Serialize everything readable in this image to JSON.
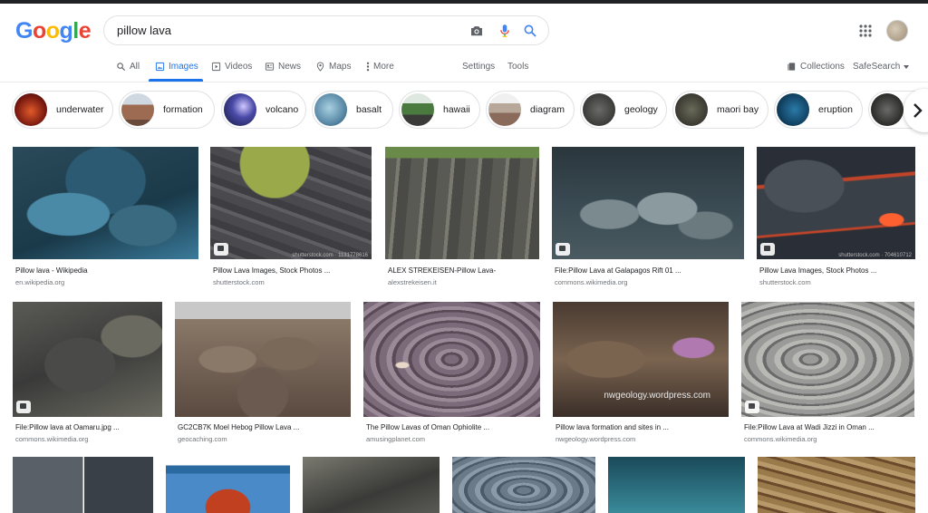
{
  "logo": {
    "letters": [
      "G",
      "o",
      "o",
      "g",
      "l",
      "e"
    ]
  },
  "search": {
    "query": "pillow lava"
  },
  "nav": {
    "tabs": [
      {
        "label": "All",
        "icon": "search-icon"
      },
      {
        "label": "Images",
        "icon": "image-icon",
        "active": true
      },
      {
        "label": "Videos",
        "icon": "play-icon"
      },
      {
        "label": "News",
        "icon": "newspaper-icon"
      },
      {
        "label": "Maps",
        "icon": "pin-icon"
      },
      {
        "label": "More",
        "icon": "more-dots-icon"
      }
    ],
    "settings": "Settings",
    "tools": "Tools",
    "collections": "Collections",
    "safesearch": "SafeSearch"
  },
  "chips": [
    {
      "label": "underwater",
      "color": "#c0392b"
    },
    {
      "label": "formation",
      "color": "#9c6b52"
    },
    {
      "label": "volcano",
      "color": "#3f4f9a"
    },
    {
      "label": "basalt",
      "color": "#6fa3bf"
    },
    {
      "label": "hawaii",
      "color": "#5a7a45"
    },
    {
      "label": "diagram",
      "color": "#b8a89a"
    },
    {
      "label": "geology",
      "color": "#4a4a48"
    },
    {
      "label": "maori bay",
      "color": "#4d4a40"
    },
    {
      "label": "eruption",
      "color": "#1f5f85"
    },
    {
      "label": "",
      "color": "#3a3a38"
    }
  ],
  "results_row1": [
    {
      "title": "Pillow lava - Wikipedia",
      "source": "en.wikipedia.org",
      "colors": [
        "#2c5a72",
        "#4a8aa6",
        "#1a3a4a"
      ]
    },
    {
      "title": "Pillow Lava Images, Stock Photos ...",
      "source": "shutterstock.com",
      "colors": [
        "#6f7a38",
        "#4a4a4e",
        "#8a9a4a"
      ],
      "watermark": "shutterstock.com · 1131778616"
    },
    {
      "title": "ALEX STREKEISEN-Pillow Lava-",
      "source": "alexstrekeisen.it",
      "colors": [
        "#5a5a55",
        "#7a7a70",
        "#9a9a90"
      ]
    },
    {
      "title": "File:Pillow Lava at Galapagos Rift 01 ...",
      "source": "commons.wikimedia.org",
      "colors": [
        "#3a4a52",
        "#6a7a7e",
        "#2a363c"
      ]
    },
    {
      "title": "Pillow Lava Images, Stock Photos ...",
      "source": "shutterstock.com",
      "colors": [
        "#2a2e36",
        "#c0442a",
        "#4a5058"
      ],
      "watermark": "shutterstock.com · 704610712"
    }
  ],
  "results_row2": [
    {
      "title": "File:Pillow lava at Oamaru.jpg ...",
      "source": "commons.wikimedia.org",
      "colors": [
        "#3a3a3a",
        "#5a5a55",
        "#6a6a60"
      ]
    },
    {
      "title": "GC2CB7K Moel Hebog Pillow Lava ...",
      "source": "geocaching.com",
      "colors": [
        "#6a5a50",
        "#8a7868",
        "#a89888"
      ]
    },
    {
      "title": "The Pillow Lavas of Oman Ophiolite ...",
      "source": "amusingplanet.com",
      "colors": [
        "#5a4a58",
        "#7a6a7a",
        "#9a8a98"
      ]
    },
    {
      "title": "Pillow lava formation and sites in ...",
      "source": "nwgeology.wordpress.com",
      "colors": [
        "#4a3a30",
        "#7a6450",
        "#9a6a9a"
      ],
      "watermark": "nwgeology.wordpress.com"
    },
    {
      "title": "File:Pillow Lava at Wadi Jizzi in Oman ...",
      "source": "commons.wikimedia.org",
      "colors": [
        "#6a6a6a",
        "#9a9a98",
        "#b8b8b4"
      ]
    }
  ],
  "results_row3": [
    {
      "colors": [
        "#4a5058",
        "#6a7078",
        "#3a4048"
      ]
    },
    {
      "colors": [
        "#2a6aa0",
        "#c04020",
        "#4a8ac8"
      ]
    },
    {
      "colors": [
        "#3a3a38",
        "#5a5a55",
        "#7a7a70"
      ]
    },
    {
      "colors": [
        "#4a5a68",
        "#6a7a88",
        "#8a9aa8"
      ]
    },
    {
      "colors": [
        "#1a4a5a",
        "#2a6a7a",
        "#3a8a9a"
      ]
    },
    {
      "colors": [
        "#6a4a2a",
        "#9a7a4a",
        "#b89a6a"
      ]
    }
  ]
}
